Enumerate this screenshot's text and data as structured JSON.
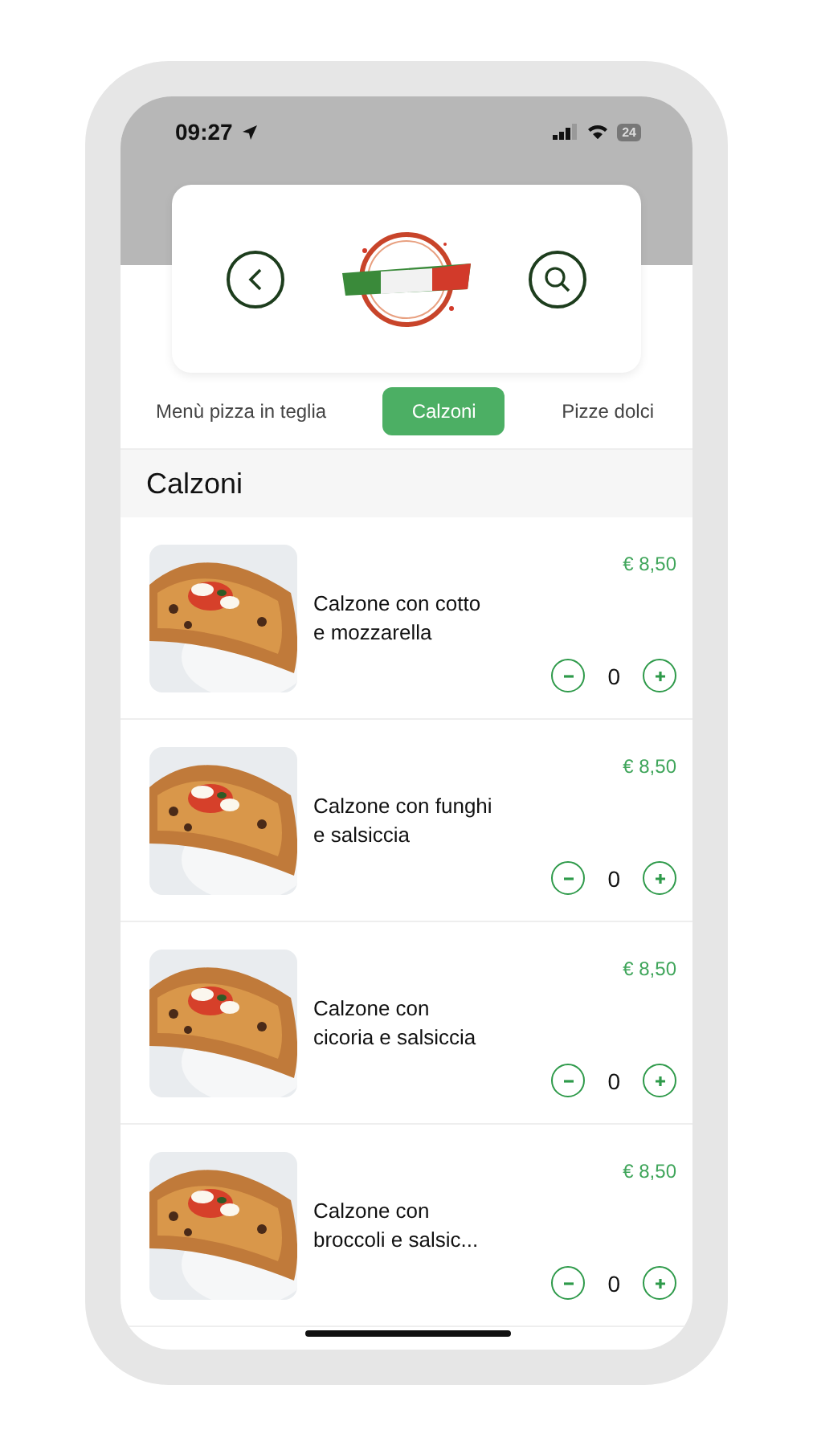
{
  "status_bar": {
    "time": "09:27",
    "battery": "24"
  },
  "tabs": [
    {
      "label": "Menù pizza in teglia",
      "selected": false
    },
    {
      "label": "Calzoni",
      "selected": true
    },
    {
      "label": "Pizze dolci",
      "selected": false
    }
  ],
  "section": {
    "title": "Calzoni"
  },
  "items": [
    {
      "name": "Calzone con cotto e mozzarella",
      "price": "€ 8,50",
      "quantity": "0"
    },
    {
      "name": "Calzone con funghi e salsiccia",
      "price": "€ 8,50",
      "quantity": "0"
    },
    {
      "name": "Calzone con cicoria e salsiccia",
      "price": "€ 8,50",
      "quantity": "0"
    },
    {
      "name": "Calzone con broccoli e salsic...",
      "price": "€ 8,50",
      "quantity": "0"
    }
  ]
}
